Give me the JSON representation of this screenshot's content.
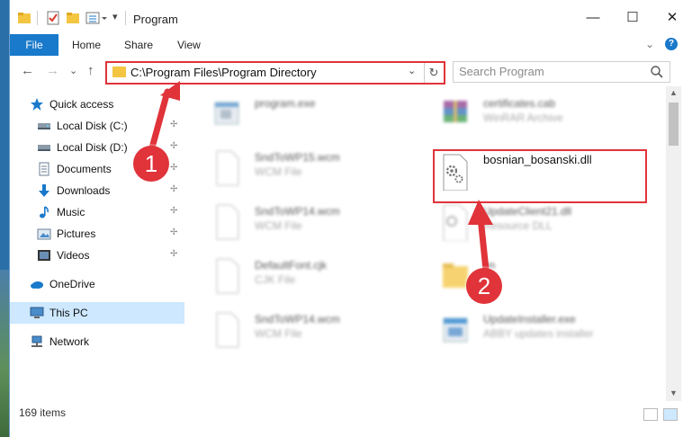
{
  "window": {
    "title": "Program",
    "controls": {
      "minimize": "—",
      "maximize": "☐",
      "close": "✕"
    }
  },
  "ribbon": {
    "tabs": [
      "File",
      "Home",
      "Share",
      "View"
    ],
    "expand_glyph": "⌄",
    "help_glyph": "?"
  },
  "nav": {
    "back_glyph": "←",
    "forward_glyph": "→",
    "recent_glyph": "⌄",
    "up_glyph": "↑",
    "address": "C:\\Program Files\\Program Directory",
    "address_dropdown_glyph": "⌄",
    "refresh_glyph": "↻",
    "search_placeholder": "Search Program"
  },
  "sidebar": {
    "items": [
      {
        "label": "Quick access",
        "icon": "star-icon",
        "pinned": false
      },
      {
        "label": "Local Disk (C:)",
        "icon": "drive-icon",
        "pinned": true
      },
      {
        "label": "Local Disk (D:)",
        "icon": "drive-icon",
        "pinned": true
      },
      {
        "label": "Documents",
        "icon": "documents-icon",
        "pinned": true
      },
      {
        "label": "Downloads",
        "icon": "downloads-icon",
        "pinned": true
      },
      {
        "label": "Music",
        "icon": "music-icon",
        "pinned": true
      },
      {
        "label": "Pictures",
        "icon": "pictures-icon",
        "pinned": true
      },
      {
        "label": "Videos",
        "icon": "videos-icon",
        "pinned": true
      },
      {
        "label": "OneDrive",
        "icon": "cloud-icon",
        "pinned": false
      },
      {
        "label": "This PC",
        "icon": "pc-icon",
        "pinned": false,
        "selected": true
      },
      {
        "label": "Network",
        "icon": "network-icon",
        "pinned": false
      }
    ],
    "pin_glyph": "📌"
  },
  "files": {
    "left": [
      {
        "name": "program.exe",
        "type": "",
        "icon": "exe-icon"
      },
      {
        "name": "SndToWP15.wcm",
        "type": "WCM File",
        "icon": "blank-file-icon"
      },
      {
        "name": "SndToWP14.wcm",
        "type": "WCM File",
        "icon": "blank-file-icon"
      },
      {
        "name": "DefaultFont.cjk",
        "type": "CJK File",
        "icon": "blank-file-icon"
      },
      {
        "name": "SndToWP14.wcm",
        "type": "WCM File",
        "icon": "blank-file-icon"
      }
    ],
    "right": [
      {
        "name": "certificates.cab",
        "type": "WinRAR Archive",
        "icon": "archive-icon"
      },
      {
        "name": "bosnian_bosanski.dll",
        "type": "",
        "icon": "dll-icon",
        "highlighted": true
      },
      {
        "name": "UpdateClient21.dll",
        "type": "Resource DLL",
        "icon": "dll-icon"
      },
      {
        "name": "en",
        "type": "",
        "icon": "folder-icon"
      },
      {
        "name": "UpdateInstaller.exe",
        "type": "ABBY updates installer",
        "icon": "installer-icon"
      }
    ]
  },
  "status": {
    "items_count": "169 items"
  },
  "annotations": {
    "step1": "1",
    "step2": "2",
    "color": "#e0333a"
  }
}
